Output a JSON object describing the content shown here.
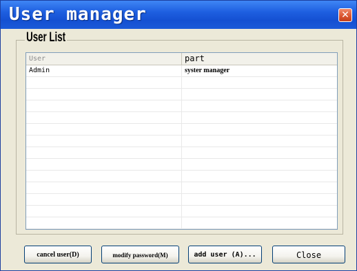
{
  "window": {
    "title": "User manager",
    "close_glyph": "✕"
  },
  "group": {
    "legend": "User List"
  },
  "table": {
    "columns": [
      "User",
      "part"
    ],
    "rows": [
      [
        "Admin",
        "syster manager"
      ],
      [
        "",
        ""
      ],
      [
        "",
        ""
      ],
      [
        "",
        ""
      ],
      [
        "",
        ""
      ],
      [
        "",
        ""
      ],
      [
        "",
        ""
      ],
      [
        "",
        ""
      ],
      [
        "",
        ""
      ],
      [
        "",
        ""
      ],
      [
        "",
        ""
      ],
      [
        "",
        ""
      ],
      [
        "",
        ""
      ],
      [
        "",
        ""
      ]
    ]
  },
  "buttons": {
    "cancel_user": "cancel user(D)",
    "modify_password": "modify password(M)",
    "add_user": "add user (A)...",
    "close": "Close"
  }
}
